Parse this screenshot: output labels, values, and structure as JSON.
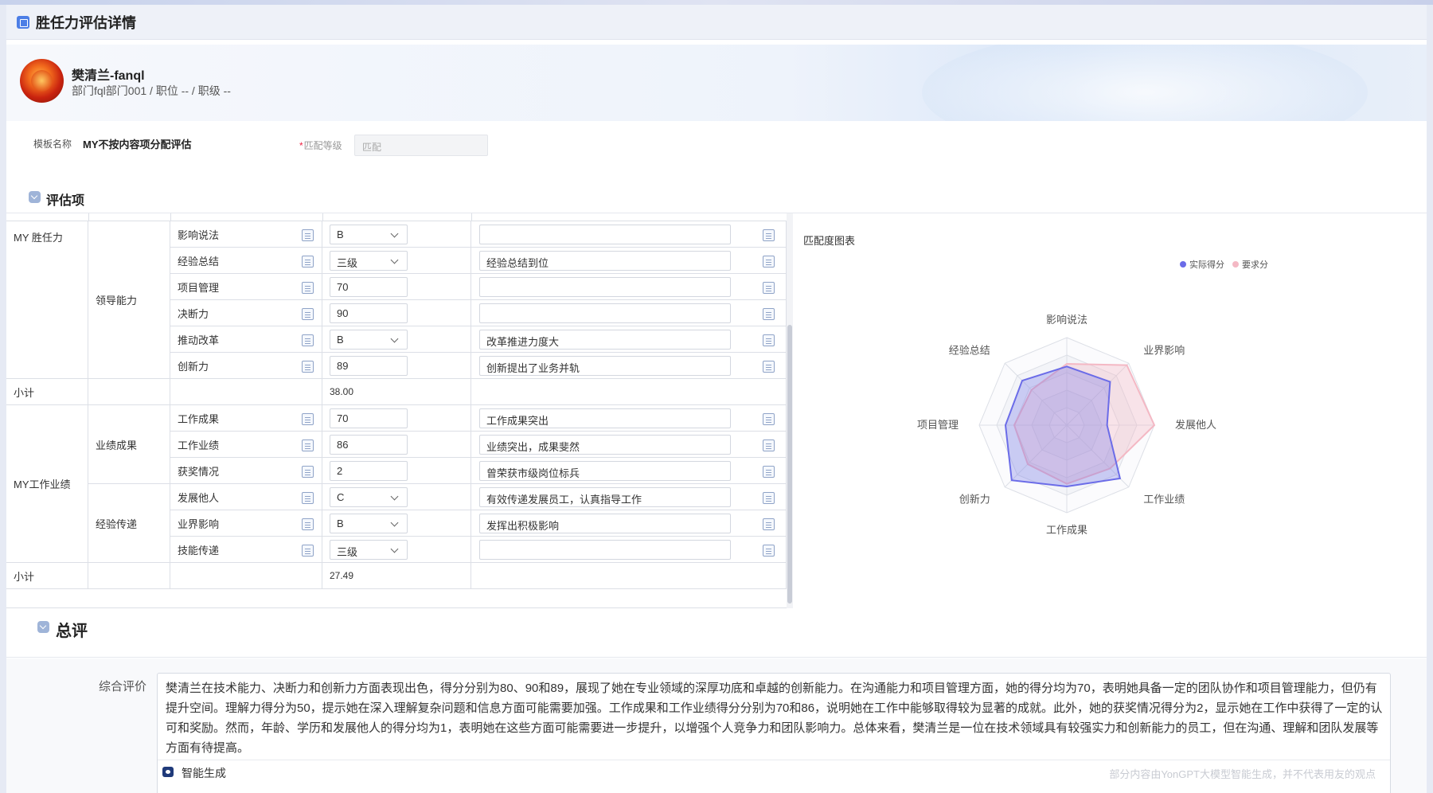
{
  "window": {
    "title": "胜任力评估详情"
  },
  "profile": {
    "name": "樊清兰-fanql",
    "dept_line": "部门fql部门001 / 职位 -- / 职级 --"
  },
  "form": {
    "template_label": "模板名称",
    "template_value": "MY不按内容项分配评估",
    "match_label": "匹配等级",
    "match_required": "*",
    "match_placeholder": "匹配"
  },
  "sections": {
    "items_title": "评估项",
    "summary_title": "总评"
  },
  "table": {
    "groups": [
      {
        "name": "MY 胜任力"
      },
      {
        "name": "MY工作业绩"
      }
    ],
    "subgroups": [
      {
        "name": "领导能力"
      },
      {
        "name": "业绩成果"
      },
      {
        "name": "经验传递"
      }
    ],
    "rows": [
      {
        "item": "影响说法",
        "type": "select",
        "value": "B",
        "comment": ""
      },
      {
        "item": "经验总结",
        "type": "select",
        "value": "三级",
        "comment": "经验总结到位"
      },
      {
        "item": "项目管理",
        "type": "number",
        "value": "70",
        "comment": ""
      },
      {
        "item": "决断力",
        "type": "number",
        "value": "90",
        "comment": ""
      },
      {
        "item": "推动改革",
        "type": "select",
        "value": "B",
        "comment": "改革推进力度大"
      },
      {
        "item": "创新力",
        "type": "number",
        "value": "89",
        "comment": "创新提出了业务并轨"
      },
      {
        "item": "工作成果",
        "type": "number",
        "value": "70",
        "comment": "工作成果突出"
      },
      {
        "item": "工作业绩",
        "type": "number",
        "value": "86",
        "comment": "业绩突出，成果斐然"
      },
      {
        "item": "获奖情况",
        "type": "number",
        "value": "2",
        "comment": "曾荣获市级岗位标兵"
      },
      {
        "item": "发展他人",
        "type": "select",
        "value": "C",
        "comment": "有效传递发展员工，认真指导工作"
      },
      {
        "item": "业界影响",
        "type": "select",
        "value": "B",
        "comment": "发挥出积极影响"
      },
      {
        "item": "技能传递",
        "type": "select",
        "value": "三级",
        "comment": ""
      }
    ],
    "subtotals": [
      {
        "label": "小计",
        "value": "38.00"
      },
      {
        "label": "小计",
        "value": "27.49"
      }
    ]
  },
  "chart_data": {
    "type": "radar",
    "title": "匹配度图表",
    "categories": [
      "影响说法",
      "业界影响",
      "发展他人",
      "工作业绩",
      "工作成果",
      "创新力",
      "项目管理",
      "经验总结"
    ],
    "range": [
      0,
      100
    ],
    "series": [
      {
        "name": "实际得分",
        "color": "#6b6ce8",
        "values": [
          67,
          70,
          46,
          86,
          70,
          89,
          70,
          72
        ]
      },
      {
        "name": "要求分",
        "color": "#f4b8c4",
        "values": [
          70,
          97,
          100,
          70,
          67,
          63,
          60,
          57
        ]
      }
    ],
    "legend_position": "top-right"
  },
  "summary": {
    "label": "综合评价",
    "text": "樊清兰在技术能力、决断力和创新力方面表现出色，得分分别为80、90和89，展现了她在专业领域的深厚功底和卓越的创新能力。在沟通能力和项目管理方面，她的得分均为70，表明她具备一定的团队协作和项目管理能力，但仍有提升空间。理解力得分为50，提示她在深入理解复杂问题和信息方面可能需要加强。工作成果和工作业绩得分分别为70和86，说明她在工作中能够取得较为显著的成就。此外，她的获奖情况得分为2，显示她在工作中获得了一定的认可和奖励。然而，年龄、学历和发展他人的得分均为1，表明她在这些方面可能需要进一步提升，以增强个人竞争力和团队影响力。总体来看，樊清兰是一位在技术领域具有较强实力和创新能力的员工，但在沟通、理解和团队发展等方面有待提高。",
    "ai_button": "智能生成",
    "disclaimer": "部分内容由YonGPT大模型智能生成，并不代表用友的观点"
  }
}
